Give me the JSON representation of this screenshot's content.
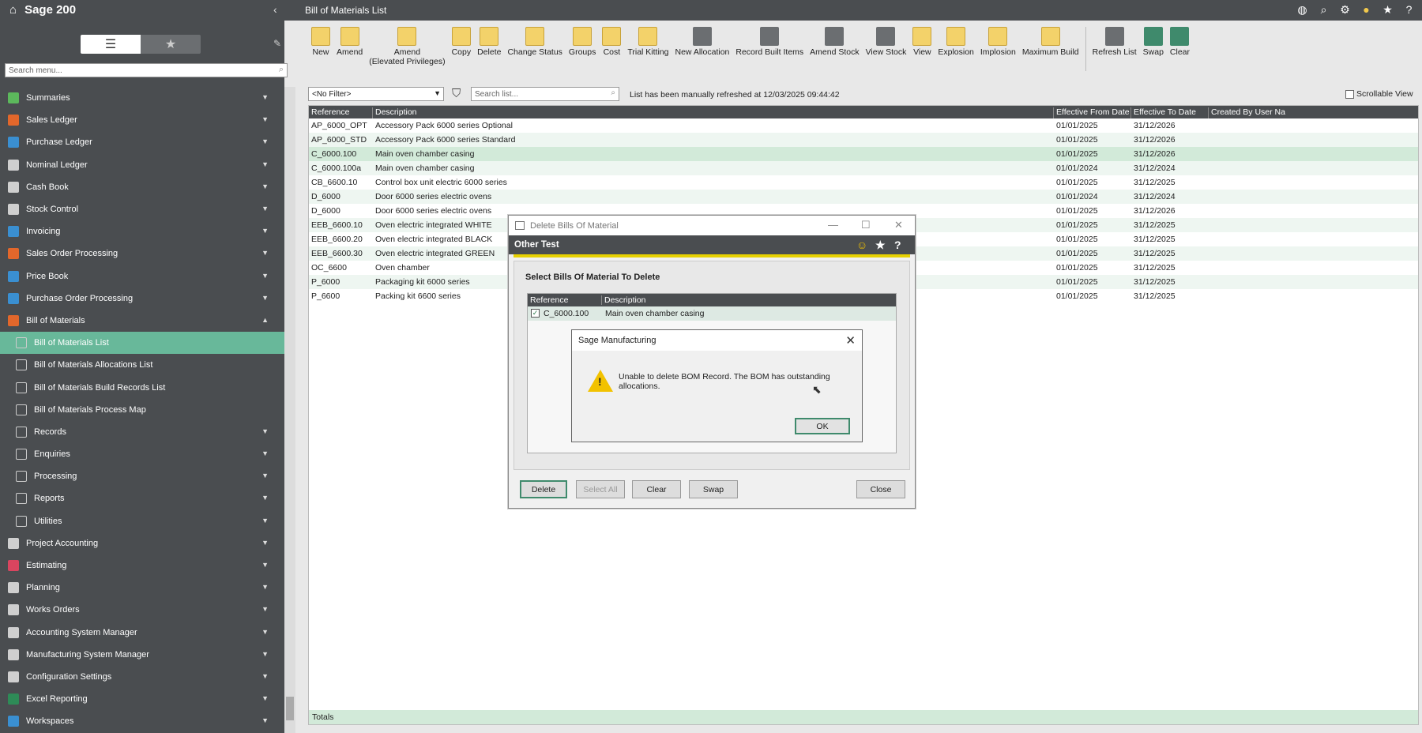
{
  "app": {
    "title": "Sage 200",
    "window_title": "Bill of Materials List"
  },
  "colors": {
    "dark": "#4a4d50",
    "accent": "#68b89a",
    "selected_row": "#d2ead9",
    "yellow": "#e6d000"
  },
  "sidebar": {
    "search_placeholder": "Search menu...",
    "items": [
      {
        "label": "Summaries",
        "icon": "pie-chart-icon",
        "color": "#5cb85c",
        "expandable": true
      },
      {
        "label": "Sales Ledger",
        "icon": "person-icon",
        "color": "#e2672b",
        "expandable": true
      },
      {
        "label": "Purchase Ledger",
        "icon": "person-icon",
        "color": "#3a8fd1",
        "expandable": true
      },
      {
        "label": "Nominal Ledger",
        "icon": "book-icon",
        "color": "#cfcfcf",
        "expandable": true
      },
      {
        "label": "Cash Book",
        "icon": "bank-icon",
        "color": "#cfcfcf",
        "expandable": true
      },
      {
        "label": "Stock Control",
        "icon": "hierarchy-icon",
        "color": "#cfcfcf",
        "expandable": true
      },
      {
        "label": "Invoicing",
        "icon": "invoice-icon",
        "color": "#3a8fd1",
        "expandable": true
      },
      {
        "label": "Sales Order Processing",
        "icon": "order-icon",
        "color": "#e2672b",
        "expandable": true
      },
      {
        "label": "Price Book",
        "icon": "pricebook-icon",
        "color": "#3a8fd1",
        "expandable": true
      },
      {
        "label": "Purchase Order Processing",
        "icon": "order-icon",
        "color": "#3a8fd1",
        "expandable": true
      },
      {
        "label": "Bill of Materials",
        "icon": "bom-icon",
        "color": "#e2672b",
        "expandable": true,
        "expanded": true
      }
    ],
    "sub_items": [
      {
        "label": "Bill of Materials List",
        "active": true
      },
      {
        "label": "Bill of Materials Allocations List"
      },
      {
        "label": "Bill of Materials Build Records List"
      },
      {
        "label": "Bill of Materials Process Map"
      },
      {
        "label": "Records",
        "expandable": true
      },
      {
        "label": "Enquiries",
        "expandable": true
      },
      {
        "label": "Processing",
        "expandable": true
      },
      {
        "label": "Reports",
        "expandable": true
      },
      {
        "label": "Utilities",
        "expandable": true
      }
    ],
    "items_after": [
      {
        "label": "Project Accounting",
        "icon": "project-icon",
        "color": "#cfcfcf"
      },
      {
        "label": "Estimating",
        "icon": "estimate-icon",
        "color": "#d9455f"
      },
      {
        "label": "Planning",
        "icon": "planning-icon",
        "color": "#cfcfcf"
      },
      {
        "label": "Works Orders",
        "icon": "works-icon",
        "color": "#cfcfcf"
      },
      {
        "label": "Accounting System Manager",
        "icon": "system-icon",
        "color": "#cfcfcf"
      },
      {
        "label": "Manufacturing System Manager",
        "icon": "system-icon",
        "color": "#cfcfcf"
      },
      {
        "label": "Configuration Settings",
        "icon": "gear-icon",
        "color": "#cfcfcf"
      },
      {
        "label": "Excel Reporting",
        "icon": "excel-icon",
        "color": "#2e8b57"
      },
      {
        "label": "Workspaces",
        "icon": "workspace-icon",
        "color": "#3a8fd1"
      }
    ]
  },
  "toolbar": [
    {
      "label": "New",
      "icon": "new-icon",
      "kind": "doc"
    },
    {
      "label": "Amend",
      "icon": "amend-icon",
      "kind": "doc"
    },
    {
      "label": "Amend\n(Elevated Privileges)",
      "icon": "amend-elevated-icon",
      "kind": "doc"
    },
    {
      "label": "Copy",
      "icon": "copy-icon",
      "kind": "doc"
    },
    {
      "label": "Delete",
      "icon": "delete-icon",
      "kind": "doc"
    },
    {
      "label": "Change Status",
      "icon": "change-status-icon",
      "kind": "doc"
    },
    {
      "label": "Groups",
      "icon": "groups-icon",
      "kind": "doc"
    },
    {
      "label": "Cost",
      "icon": "cost-icon",
      "kind": "doc"
    },
    {
      "label": "Trial Kitting",
      "icon": "trial-kitting-icon",
      "kind": "doc"
    },
    {
      "label": "New Allocation",
      "icon": "new-allocation-icon",
      "kind": "sq"
    },
    {
      "label": "Record Built Items",
      "icon": "record-built-icon",
      "kind": "sq"
    },
    {
      "label": "Amend Stock",
      "icon": "amend-stock-icon",
      "kind": "sq"
    },
    {
      "label": "View Stock",
      "icon": "view-stock-icon",
      "kind": "sq"
    },
    {
      "label": "View",
      "icon": "view-icon",
      "kind": "doc"
    },
    {
      "label": "Explosion",
      "icon": "explosion-icon",
      "kind": "doc"
    },
    {
      "label": "Implosion",
      "icon": "implosion-icon",
      "kind": "doc"
    },
    {
      "label": "Maximum Build",
      "icon": "maximum-build-icon",
      "kind": "doc"
    },
    {
      "label": "Refresh List",
      "icon": "refresh-icon",
      "kind": "sq"
    },
    {
      "label": "Swap",
      "icon": "swap-icon",
      "kind": "grn"
    },
    {
      "label": "Clear",
      "icon": "clear-icon",
      "kind": "grn"
    }
  ],
  "filter": {
    "value": "<No Filter>",
    "search_placeholder": "Search list...",
    "refresh_message": "List has been manually refreshed at 12/03/2025 09:44:42",
    "scrollable_view": "Scrollable View"
  },
  "grid": {
    "columns": [
      "Reference",
      "Description",
      "Effective From Date",
      "Effective To Date",
      "Created By User Na"
    ],
    "rows": [
      {
        "ref": "AP_6000_OPT",
        "desc": "Accessory Pack 6000 series Optional",
        "from": "01/01/2025",
        "to": "31/12/2026"
      },
      {
        "ref": "AP_6000_STD",
        "desc": "Accessory Pack 6000 series Standard",
        "from": "01/01/2025",
        "to": "31/12/2026"
      },
      {
        "ref": "C_6000.100",
        "desc": "Main oven chamber casing",
        "from": "01/01/2025",
        "to": "31/12/2026",
        "selected": true
      },
      {
        "ref": "C_6000.100a",
        "desc": "Main oven chamber casing",
        "from": "01/01/2024",
        "to": "31/12/2024"
      },
      {
        "ref": "CB_6600.10",
        "desc": "Control box unit electric 6000 series",
        "from": "01/01/2025",
        "to": "31/12/2025"
      },
      {
        "ref": "D_6000",
        "desc": "Door 6000 series electric ovens",
        "from": "01/01/2024",
        "to": "31/12/2024"
      },
      {
        "ref": "D_6000",
        "desc": "Door 6000 series electric ovens",
        "from": "01/01/2025",
        "to": "31/12/2026"
      },
      {
        "ref": "EEB_6600.10",
        "desc": "Oven electric integrated WHITE",
        "from": "01/01/2025",
        "to": "31/12/2025"
      },
      {
        "ref": "EEB_6600.20",
        "desc": "Oven electric integrated BLACK",
        "from": "01/01/2025",
        "to": "31/12/2025"
      },
      {
        "ref": "EEB_6600.30",
        "desc": "Oven electric integrated GREEN",
        "from": "01/01/2025",
        "to": "31/12/2025"
      },
      {
        "ref": "OC_6600",
        "desc": "Oven chamber",
        "from": "01/01/2025",
        "to": "31/12/2025"
      },
      {
        "ref": "P_6000",
        "desc": "Packaging kit 6000 series",
        "from": "01/01/2025",
        "to": "31/12/2025"
      },
      {
        "ref": "P_6600",
        "desc": "Packing kit 6600 series",
        "from": "01/01/2025",
        "to": "31/12/2025"
      }
    ],
    "totals_label": "Totals"
  },
  "delete_dialog": {
    "title": "Delete Bills Of Material",
    "header": "Other Test",
    "section": "Select Bills Of Material To Delete",
    "columns": [
      "Reference",
      "Description"
    ],
    "rows": [
      {
        "ref": "C_6000.100",
        "desc": "Main oven chamber casing",
        "checked": true
      }
    ],
    "buttons": {
      "delete": "Delete",
      "select_all": "Select All",
      "clear": "Clear",
      "swap": "Swap",
      "close": "Close"
    }
  },
  "message_box": {
    "title": "Sage Manufacturing",
    "text": "Unable to delete BOM Record. The BOM has outstanding allocations.",
    "ok": "OK"
  }
}
